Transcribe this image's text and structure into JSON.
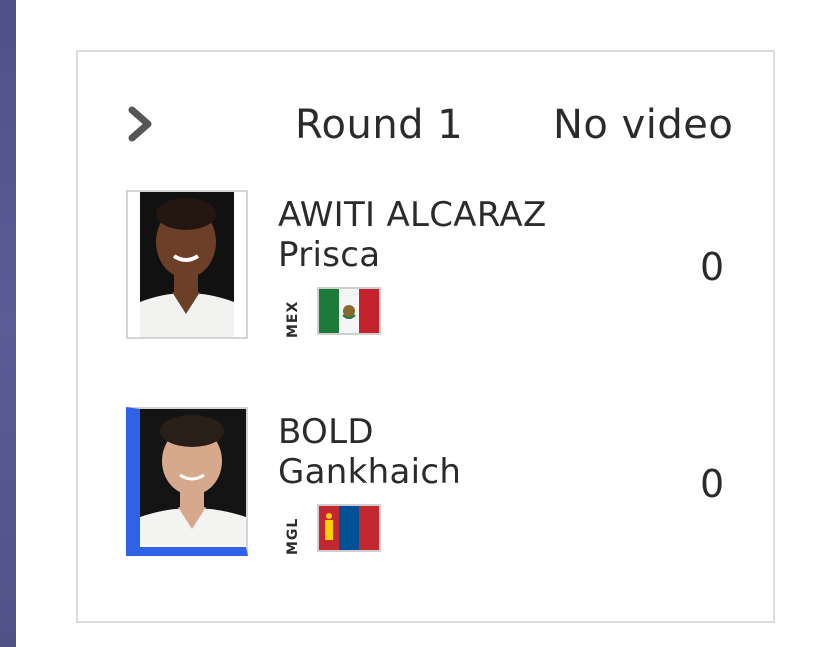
{
  "match": {
    "round": "Round 1",
    "video": "No video"
  },
  "competitors": [
    {
      "last_name": "AWITI ALCARAZ",
      "first_name": "Prisca",
      "country_code": "MEX",
      "score": "0",
      "flag": "mexico-flag",
      "highlight": false
    },
    {
      "last_name": "BOLD",
      "first_name": "Gankhaich",
      "country_code": "MGL",
      "score": "0",
      "flag": "mongolia-flag",
      "highlight": true,
      "highlight_color": "#2f63e6"
    }
  ],
  "colors": {
    "sidebar": "#5a5c95",
    "card_border": "#dcdcdc",
    "text": "#2b2b2b",
    "accent_blue": "#2f63e6"
  }
}
